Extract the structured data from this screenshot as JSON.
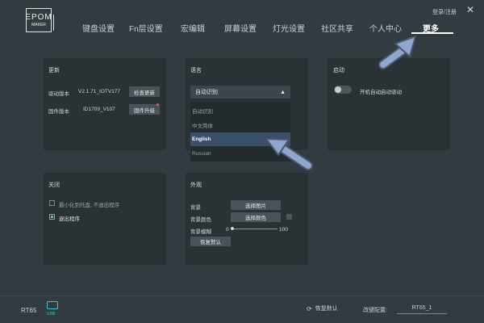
{
  "logo": {
    "line1": "EPOM",
    "line2": "MAKER"
  },
  "top": {
    "login": "登录/注册",
    "close_glyph": "✕"
  },
  "nav": {
    "tabs": [
      "键盘设置",
      "Fn层设置",
      "宏编辑",
      "屏幕设置",
      "灯光设置",
      "社区共享",
      "个人中心",
      "更多"
    ],
    "active_index": 7
  },
  "update_panel": {
    "title": "更新",
    "driver_label": "驱动版本",
    "driver_value": "V2.1.71_IOTV177",
    "check_button": "检查更新",
    "firmware_label": "固件版本",
    "firmware_value": "ID1709_V107",
    "upgrade_button": "固件升级"
  },
  "language_panel": {
    "title": "语言",
    "selected": "自动识别",
    "arrow": "▲",
    "options": [
      "自动识别",
      "中文简体",
      "English",
      "Russian"
    ],
    "highlighted_index": 2
  },
  "startup_panel": {
    "title": "启动",
    "toggle_label": "开机自动启动驱动",
    "toggle_on": false
  },
  "close_panel": {
    "title": "关闭",
    "opt1": "最小化到托盘, 不退出程序",
    "opt1_checked": false,
    "opt2": "退出程序",
    "opt2_checked": true
  },
  "appearance_panel": {
    "title": "外观",
    "bg_label": "背景",
    "bg_button": "选择图片",
    "color_label": "背景颜色",
    "color_button": "选择颜色",
    "blur_label": "背景模糊",
    "blur_min": "0",
    "blur_max": "100",
    "blur_value": 0,
    "reset_button": "恢复默认"
  },
  "bottom": {
    "device": "RT65",
    "usb": "USB",
    "reset_icon": "⟳",
    "reset_label": "恢复默认",
    "config_label": "改键配置:",
    "config_value": "RT65_1"
  },
  "colors": {
    "background": "#323b40",
    "panel": "#2a3236",
    "accent": "#2fd0c0",
    "arrow": "#8fa7d0",
    "selection": "#3a4f68"
  },
  "icons": [
    "close-icon",
    "usb-icon",
    "reset-icon",
    "checkbox-icon",
    "toggle-icon",
    "pointer-arrow-icon"
  ]
}
